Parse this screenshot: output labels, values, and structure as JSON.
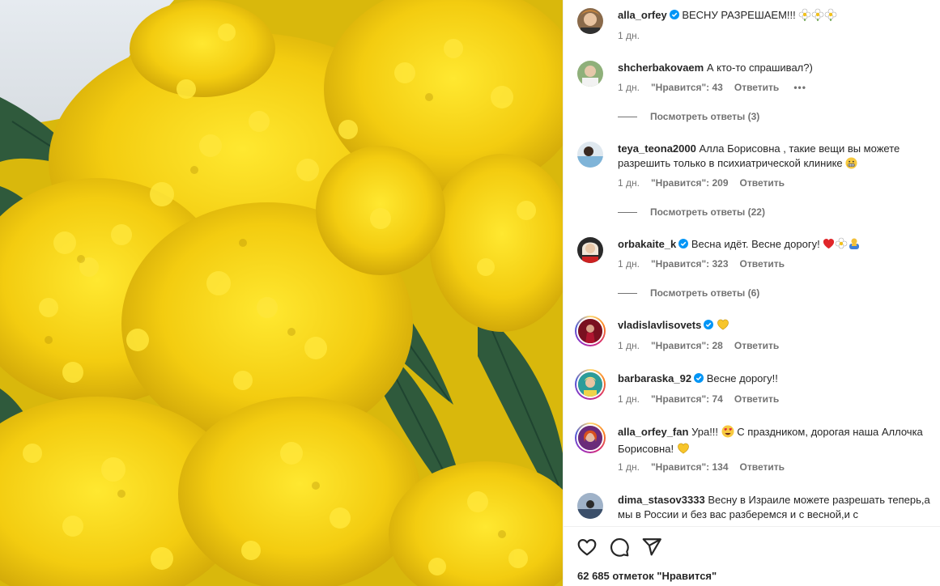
{
  "post": {
    "likes_text": "62 685 отметок \"Нравится\""
  },
  "comments": [
    {
      "user": "alla_orfey",
      "verified": true,
      "text": "ВЕСНУ РАЗРЕШАЕМ!!!",
      "emoji": [
        "flower",
        "flower",
        "flower"
      ],
      "time": "1 дн."
    },
    {
      "user": "shcherbakovaem",
      "verified": false,
      "text": "А кто-то спрашивал?)",
      "time": "1 дн.",
      "likes": "\"Нравится\": 43",
      "reply": "Ответить",
      "more": "•••",
      "view_replies": "Посмотреть ответы (3)"
    },
    {
      "user": "teya_teona2000",
      "verified": false,
      "text": "Алла Борисовна , такие вещи вы можете разрешить только в психиатрической клинике",
      "emoji": [
        "grimace"
      ],
      "time": "1 дн.",
      "likes": "\"Нравится\": 209",
      "reply": "Ответить",
      "view_replies": "Посмотреть ответы (22)"
    },
    {
      "user": "orbakaite_k",
      "verified": true,
      "text": "Весна идёт. Весне дорогу!",
      "emoji": [
        "heart",
        "flower",
        "bow"
      ],
      "time": "1 дн.",
      "likes": "\"Нравится\": 323",
      "reply": "Ответить",
      "view_replies": "Посмотреть ответы (6)"
    },
    {
      "user": "vladislavlisovets",
      "verified": true,
      "text": "",
      "emoji": [
        "yellow-heart"
      ],
      "time": "1 дн.",
      "likes": "\"Нравится\": 28",
      "reply": "Ответить"
    },
    {
      "user": "barbaraska_92",
      "verified": true,
      "text": "Весне дорогу!!",
      "time": "1 дн.",
      "likes": "\"Нравится\": 74",
      "reply": "Ответить"
    },
    {
      "user": "alla_orfey_fan",
      "verified": false,
      "text_a": "Ура!!!",
      "text_b": "С праздником, дорогая наша Аллочка Борисовна!",
      "emoji": [
        "heart-eyes",
        "yellow-heart"
      ],
      "time": "1 дн.",
      "likes": "\"Нравится\": 134",
      "reply": "Ответить"
    },
    {
      "user": "dima_stasov3333",
      "verified": false,
      "text": "Весну в Израиле можете разрешать теперь,а мы в России и без вас разберемся и с весной,и с"
    }
  ],
  "icons": {
    "like": "heart-outline-icon",
    "comment": "comment-bubble-icon",
    "share": "paper-plane-icon"
  },
  "colors": {
    "verified": "#0095f6",
    "meta": "#737373",
    "mimosa": "#f5d10f"
  }
}
